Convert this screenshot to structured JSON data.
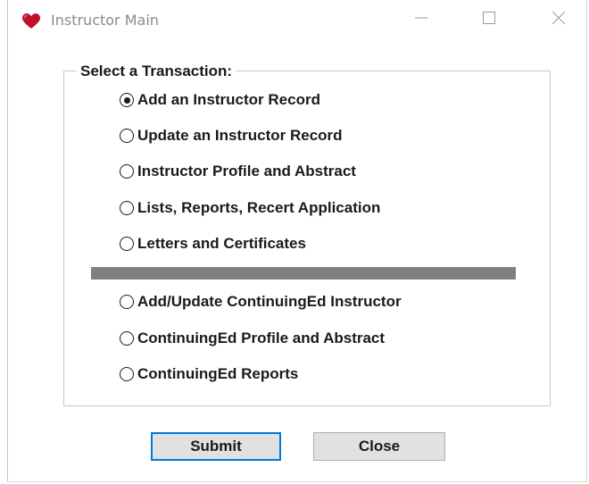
{
  "window": {
    "title": "Instructor Main",
    "app_icon": "heart-icon",
    "controls": {
      "minimize_icon": "minimize-icon",
      "maximize_icon": "maximize-icon",
      "close_icon": "close-icon"
    }
  },
  "group": {
    "legend": "Select a Transaction:",
    "options": [
      {
        "label": "Add an Instructor Record",
        "selected": true
      },
      {
        "label": "Update an Instructor Record",
        "selected": false
      },
      {
        "label": "Instructor Profile and Abstract",
        "selected": false
      },
      {
        "label": "Lists, Reports, Recert Application",
        "selected": false
      },
      {
        "label": "Letters and Certificates",
        "selected": false
      }
    ],
    "options_ce": [
      {
        "label": "Add/Update ContinuingEd Instructor",
        "selected": false
      },
      {
        "label": "ContinuingEd Profile and Abstract",
        "selected": false
      },
      {
        "label": "ContinuingEd Reports",
        "selected": false
      }
    ]
  },
  "buttons": {
    "submit_label": "Submit",
    "close_label": "Close"
  },
  "colors": {
    "heart": "#c0102a",
    "separator": "#808080",
    "focus_border": "#0078d7",
    "button_face": "#e1e1e1"
  }
}
